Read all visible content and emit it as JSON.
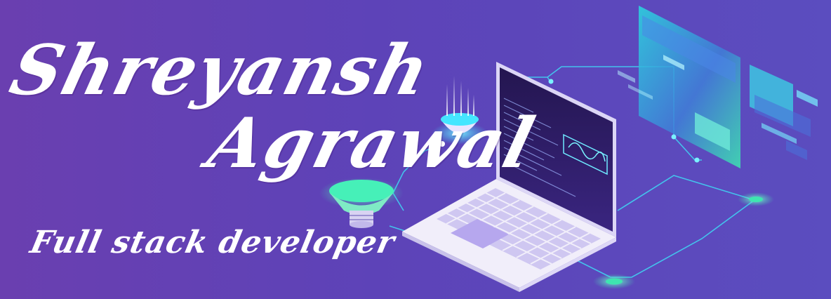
{
  "banner": {
    "first_name": "Shreyansh",
    "last_name": "Agrawal",
    "tagline": "Full stack developer"
  },
  "colors": {
    "background_left": "#6a3fb0",
    "background_right": "#5b4dbf",
    "accent_cyan": "#35e0ff",
    "accent_green": "#3ee6b0",
    "laptop_body": "#f1eefa",
    "keyboard_keys": "#c9c0ee",
    "screen_dark": "#2a1a5e",
    "text": "#ffffff"
  },
  "icons": {
    "laptop": "laptop-icon",
    "hologram_top": "data-beacon-icon",
    "hologram_left": "funnel-node-icon",
    "waveform": "waveform-icon",
    "floating_panels": "floating-screen-icon"
  }
}
